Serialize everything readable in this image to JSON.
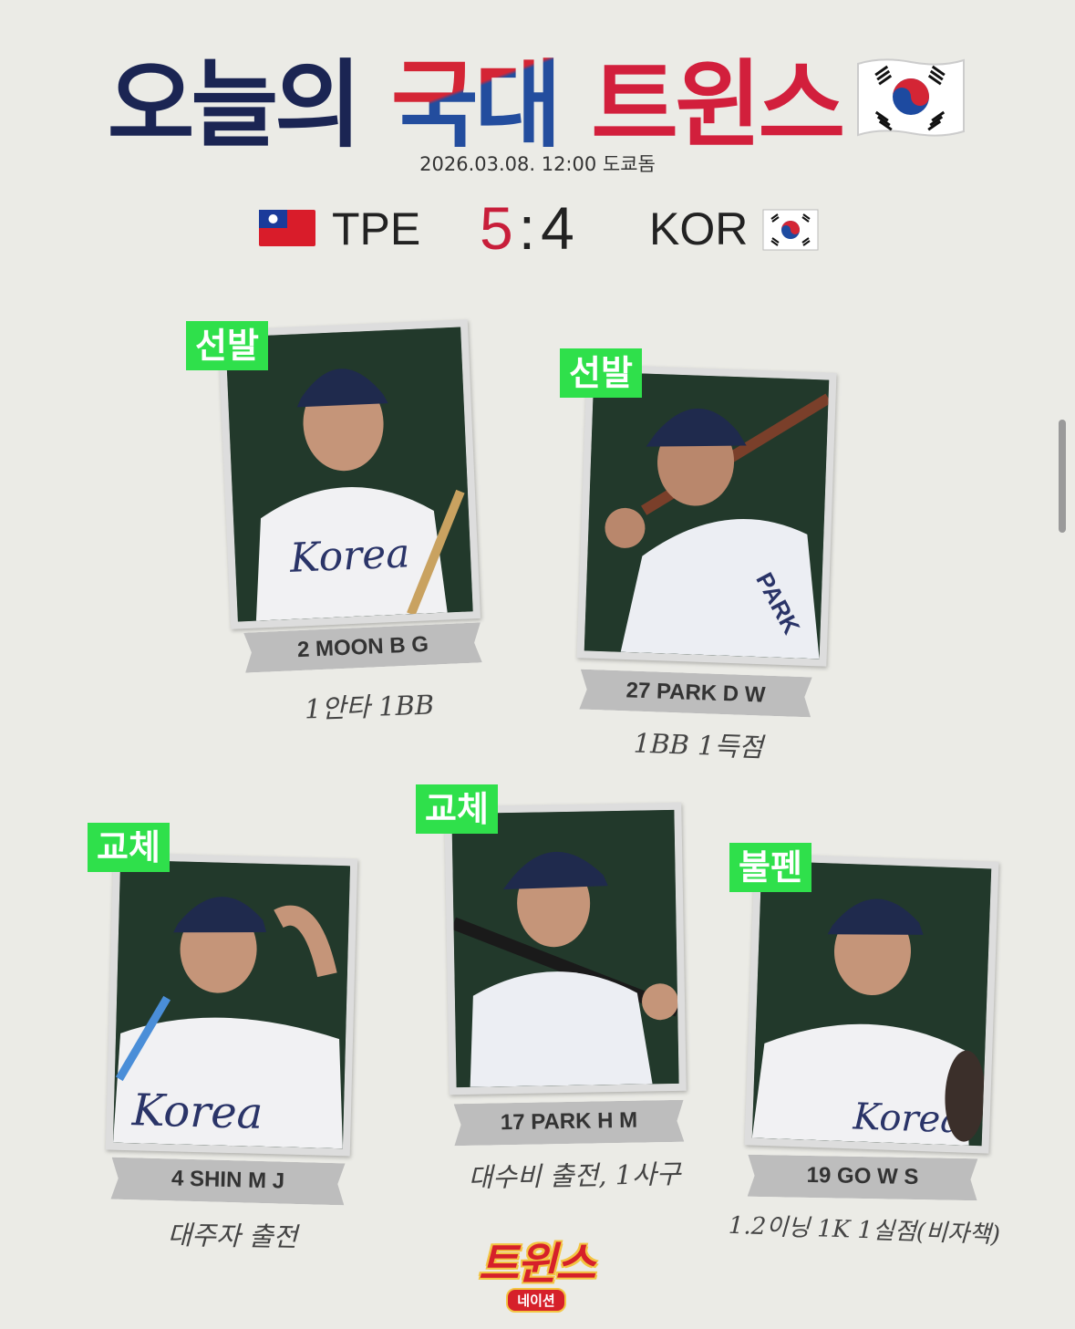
{
  "header": {
    "title_part1": "오늘의",
    "title_part2": "국대",
    "title_part3": "트윈스",
    "flag_icon": "south-korea-flag-icon",
    "subtitle": "2026.03.08. 12:00 도쿄돔"
  },
  "scoreboard": {
    "home_team": "TPE",
    "home_score": "5",
    "separator": ":",
    "away_score": "4",
    "away_team": "KOR",
    "home_flag_icon": "taiwan-flag-icon",
    "away_flag_icon": "south-korea-flag-icon",
    "colors": {
      "home_score": "#c81e3a",
      "away_score": "#222222"
    }
  },
  "players": [
    {
      "role": "선발",
      "name": "2 MOON B G",
      "stat": "1안타 1BB"
    },
    {
      "role": "선발",
      "name": "27 PARK D W",
      "stat": "1BB 1득점"
    },
    {
      "role": "교체",
      "name": "4 SHIN M J",
      "stat": "대주자 출전"
    },
    {
      "role": "교체",
      "name": "17 PARK H M",
      "stat": "대수비 출전, 1사구"
    },
    {
      "role": "불펜",
      "name": "19 GO W S",
      "stat": "1.2이닝 1K 1실점(비자책)"
    }
  ],
  "logo": {
    "main": "트윈스",
    "sub": "네이션"
  },
  "colors": {
    "background": "#ebebe6",
    "tag_green": "#2fe04b",
    "title_navy": "#1b2553",
    "title_red": "#d21f3c"
  }
}
